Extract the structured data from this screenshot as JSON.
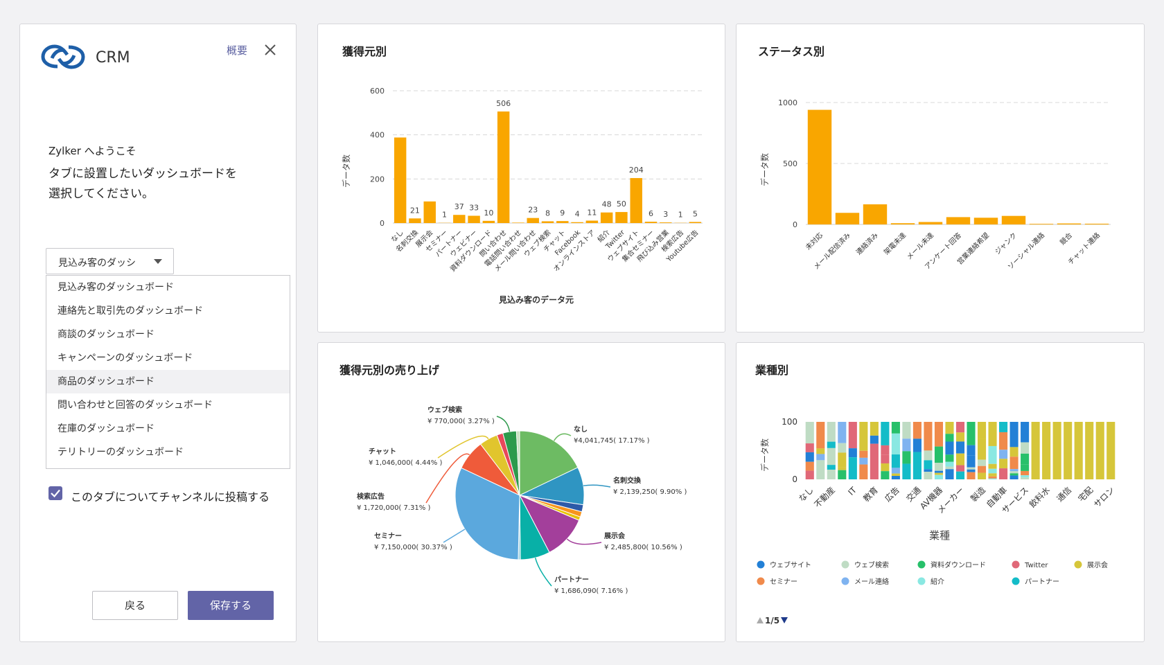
{
  "sidebar": {
    "app_name": "CRM",
    "overview_link": "概要",
    "welcome": "Zylker へようこそ",
    "instruction_line1": "タブに設置したいダッシュボードを",
    "instruction_line2": "選択してください。",
    "dropdown_selected": "見込み客のダッシ",
    "dropdown_options": [
      "見込み客のダッシュボード",
      "連絡先と取引先のダッシュボード",
      "商談のダッシュボード",
      "キャンペーンのダッシュボード",
      "商品のダッシュボード",
      "問い合わせと回答のダッシュボード",
      "在庫のダッシュボード",
      "テリトリーのダッシュボード"
    ],
    "checkbox_label": "このタブについてチャンネルに投稿する",
    "checkbox_checked": true,
    "back_button": "戻る",
    "save_button": "保存する",
    "accent_color": "#6264a7"
  },
  "charts": {
    "source": {
      "title": "獲得元別",
      "ylabel": "データ数",
      "xlabel": "見込み客のデータ元",
      "chart_data": {
        "type": "bar",
        "color": "#f9a600",
        "ylim": [
          0,
          600
        ],
        "yticks": [
          0,
          200,
          400,
          600
        ],
        "grid": true,
        "categories": [
          "なし",
          "名刺交換",
          "展示会",
          "セミナー",
          "パートナー",
          "ウェビナー",
          "資料ダウンロード",
          "問い合わせ",
          "電話問い合わせ",
          "メール問い合わせ",
          "ウェブ検索",
          "チャット",
          "Facebook",
          "オンラインストア",
          "紹介",
          "Twitter",
          "ウェブサイト",
          "集合セミナー",
          "飛び込み営業",
          "検索広告",
          "Youtube広告"
        ],
        "values": [
          388,
          21,
          98,
          1,
          37,
          33,
          10,
          506,
          2,
          23,
          8,
          9,
          4,
          11,
          48,
          50,
          204,
          6,
          3,
          1,
          5
        ],
        "labels": [
          "",
          "21",
          "",
          "1",
          "37",
          "33",
          "10",
          "506",
          "",
          "23",
          "8",
          "9",
          "4",
          "11",
          "48",
          "50",
          "204",
          "6",
          "3",
          "1",
          "5"
        ]
      }
    },
    "status": {
      "title": "ステータス別",
      "ylabel": "データ数",
      "chart_data": {
        "type": "bar",
        "color": "#f9a600",
        "ylim": [
          0,
          1000
        ],
        "yticks": [
          0,
          500,
          1000
        ],
        "grid": true,
        "categories": [
          "未対応",
          "メール配信済み",
          "連絡済み",
          "架電未達",
          "メール未達",
          "アンケート回答",
          "営業連絡希望",
          "ジャンク",
          "ソーシャル連絡",
          "競合",
          "チャット連絡"
        ],
        "values": [
          940,
          95,
          165,
          10,
          20,
          60,
          55,
          70,
          5,
          8,
          6
        ]
      }
    },
    "revenue": {
      "title": "獲得元別の売り上げ",
      "chart_data": {
        "type": "pie",
        "slices": [
          {
            "name": "なし",
            "value": 4041745,
            "label": "¥4,041,745( 17.17% )",
            "color": "#6dbb63"
          },
          {
            "name": "名刺交換",
            "value": 2139250,
            "label": "¥ 2,139,250( 9.90% )",
            "color": "#2f95c2"
          },
          {
            "name": "",
            "value": 400000,
            "label": "",
            "color": "#2d5aa8"
          },
          {
            "name": "",
            "value": 300000,
            "label": "",
            "color": "#f7941d"
          },
          {
            "name": "",
            "value": 200000,
            "label": "",
            "color": "#e7c200"
          },
          {
            "name": "展示会",
            "value": 2485800,
            "label": "¥ 2,485,800( 10.56% )",
            "color": "#a33f9b"
          },
          {
            "name": "パートナー",
            "value": 1686090,
            "label": "¥ 1,686,090( 7.16% )",
            "color": "#08b0a7"
          },
          {
            "name": "",
            "value": 120000,
            "label": "",
            "color": "#9ad0df"
          },
          {
            "name": "セミナー",
            "value": 7150000,
            "label": "¥ 7,150,000( 30.37% )",
            "color": "#5ba8dd"
          },
          {
            "name": "検索広告",
            "value": 1720000,
            "label": "¥ 1,720,000( 7.31% )",
            "color": "#ef5b3a"
          },
          {
            "name": "チャット",
            "value": 1046000,
            "label": "¥ 1,046,000( 4.44% )",
            "color": "#e1c52d"
          },
          {
            "name": "",
            "value": 350000,
            "label": "",
            "color": "#e8485a"
          },
          {
            "name": "ウェブ検索",
            "value": 770000,
            "label": "¥ 770,000( 3.27% )",
            "color": "#2d9a4c"
          },
          {
            "name": "",
            "value": 180000,
            "label": "",
            "color": "#c8e0c0"
          }
        ]
      }
    },
    "industry": {
      "title": "業種別",
      "ylabel": "データ数",
      "xlabel": "業種",
      "pager": "1/5",
      "chart_data": {
        "type": "bar",
        "stacked": true,
        "ylim": [
          0,
          100
        ],
        "yticks": [
          0,
          100
        ],
        "categories": [
          "なし",
          "",
          "不動産",
          "",
          "IT",
          "",
          "教育",
          "",
          "広告",
          "",
          "交通",
          "",
          "AV機器",
          "",
          "メーカー",
          "",
          "製造",
          "",
          "自動車",
          "",
          "サービス",
          "",
          "飲料水",
          "",
          "通信",
          "",
          "宅配",
          "",
          "サロン"
        ],
        "legend": [
          {
            "name": "ウェブサイト",
            "color": "#2280d6"
          },
          {
            "name": "ウェブ検索",
            "color": "#bfdcc4"
          },
          {
            "name": "資料ダウンロード",
            "color": "#27c06a"
          },
          {
            "name": "Twitter",
            "color": "#e06878"
          },
          {
            "name": "展示会",
            "color": "#d6c63a"
          },
          {
            "name": "セミナー",
            "color": "#f08a4b"
          },
          {
            "name": "メール連絡",
            "color": "#7fb3f0"
          },
          {
            "name": "紹介",
            "color": "#8ae8e2"
          },
          {
            "name": "パートナー",
            "color": "#14bcc8"
          }
        ]
      }
    }
  }
}
